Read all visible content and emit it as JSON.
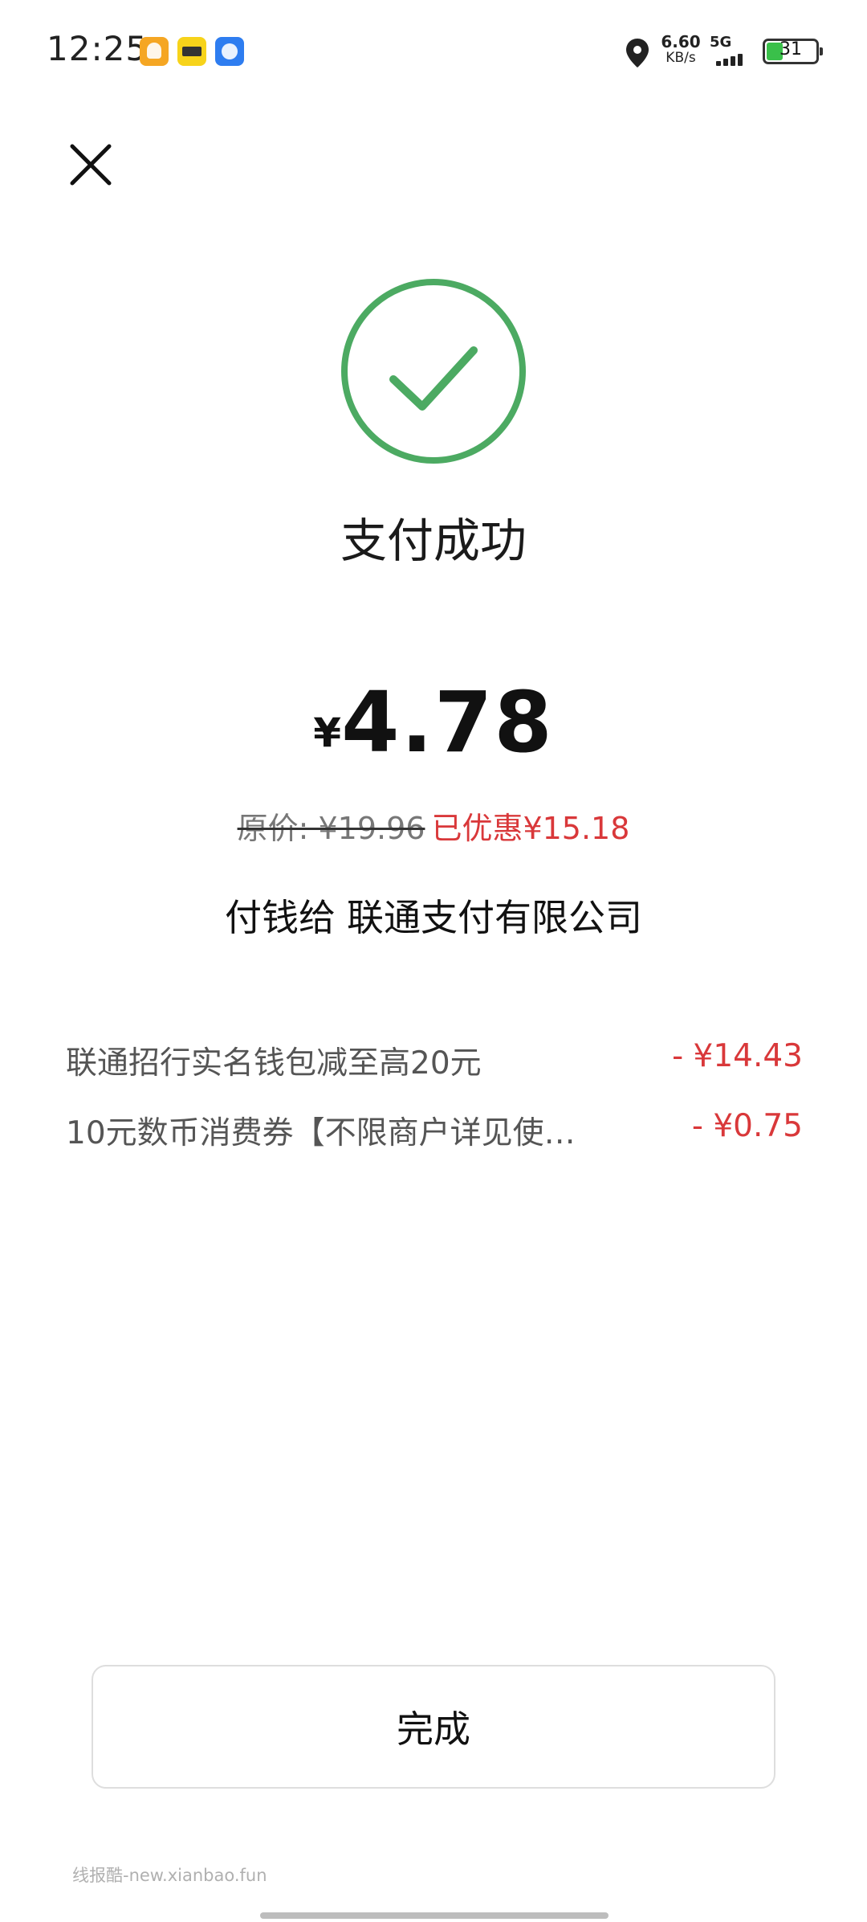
{
  "status_bar": {
    "time": "12:25",
    "net_speed_value": "6.60",
    "net_speed_unit": "KB/s",
    "network_type": "5G",
    "battery_level": "31",
    "battery_fraction": 0.31,
    "battery_color": "#3ac04a",
    "notification_icons": [
      "profile-app-icon",
      "meituan-app-icon",
      "flight-app-icon"
    ]
  },
  "header": {
    "close_icon": "close-icon"
  },
  "result": {
    "status_icon": "check-circle-icon",
    "status_color": "#4caa62",
    "title": "支付成功",
    "currency_symbol": "¥",
    "amount": "4.78",
    "original_price": "原价: ¥19.96",
    "discount_total": "已优惠¥15.18",
    "payee_prefix": "付钱给",
    "payee_name": "联通支付有限公司"
  },
  "discounts": [
    {
      "label": "联通招行实名钱包减至高20元",
      "value": "- ¥14.43"
    },
    {
      "label": "10元数币消费券【不限商户详见使…",
      "value": "- ¥0.75"
    }
  ],
  "footer": {
    "done_label": "完成",
    "watermark": "线报酷-new.xianbao.fun"
  },
  "accent_red": "#d9383a"
}
